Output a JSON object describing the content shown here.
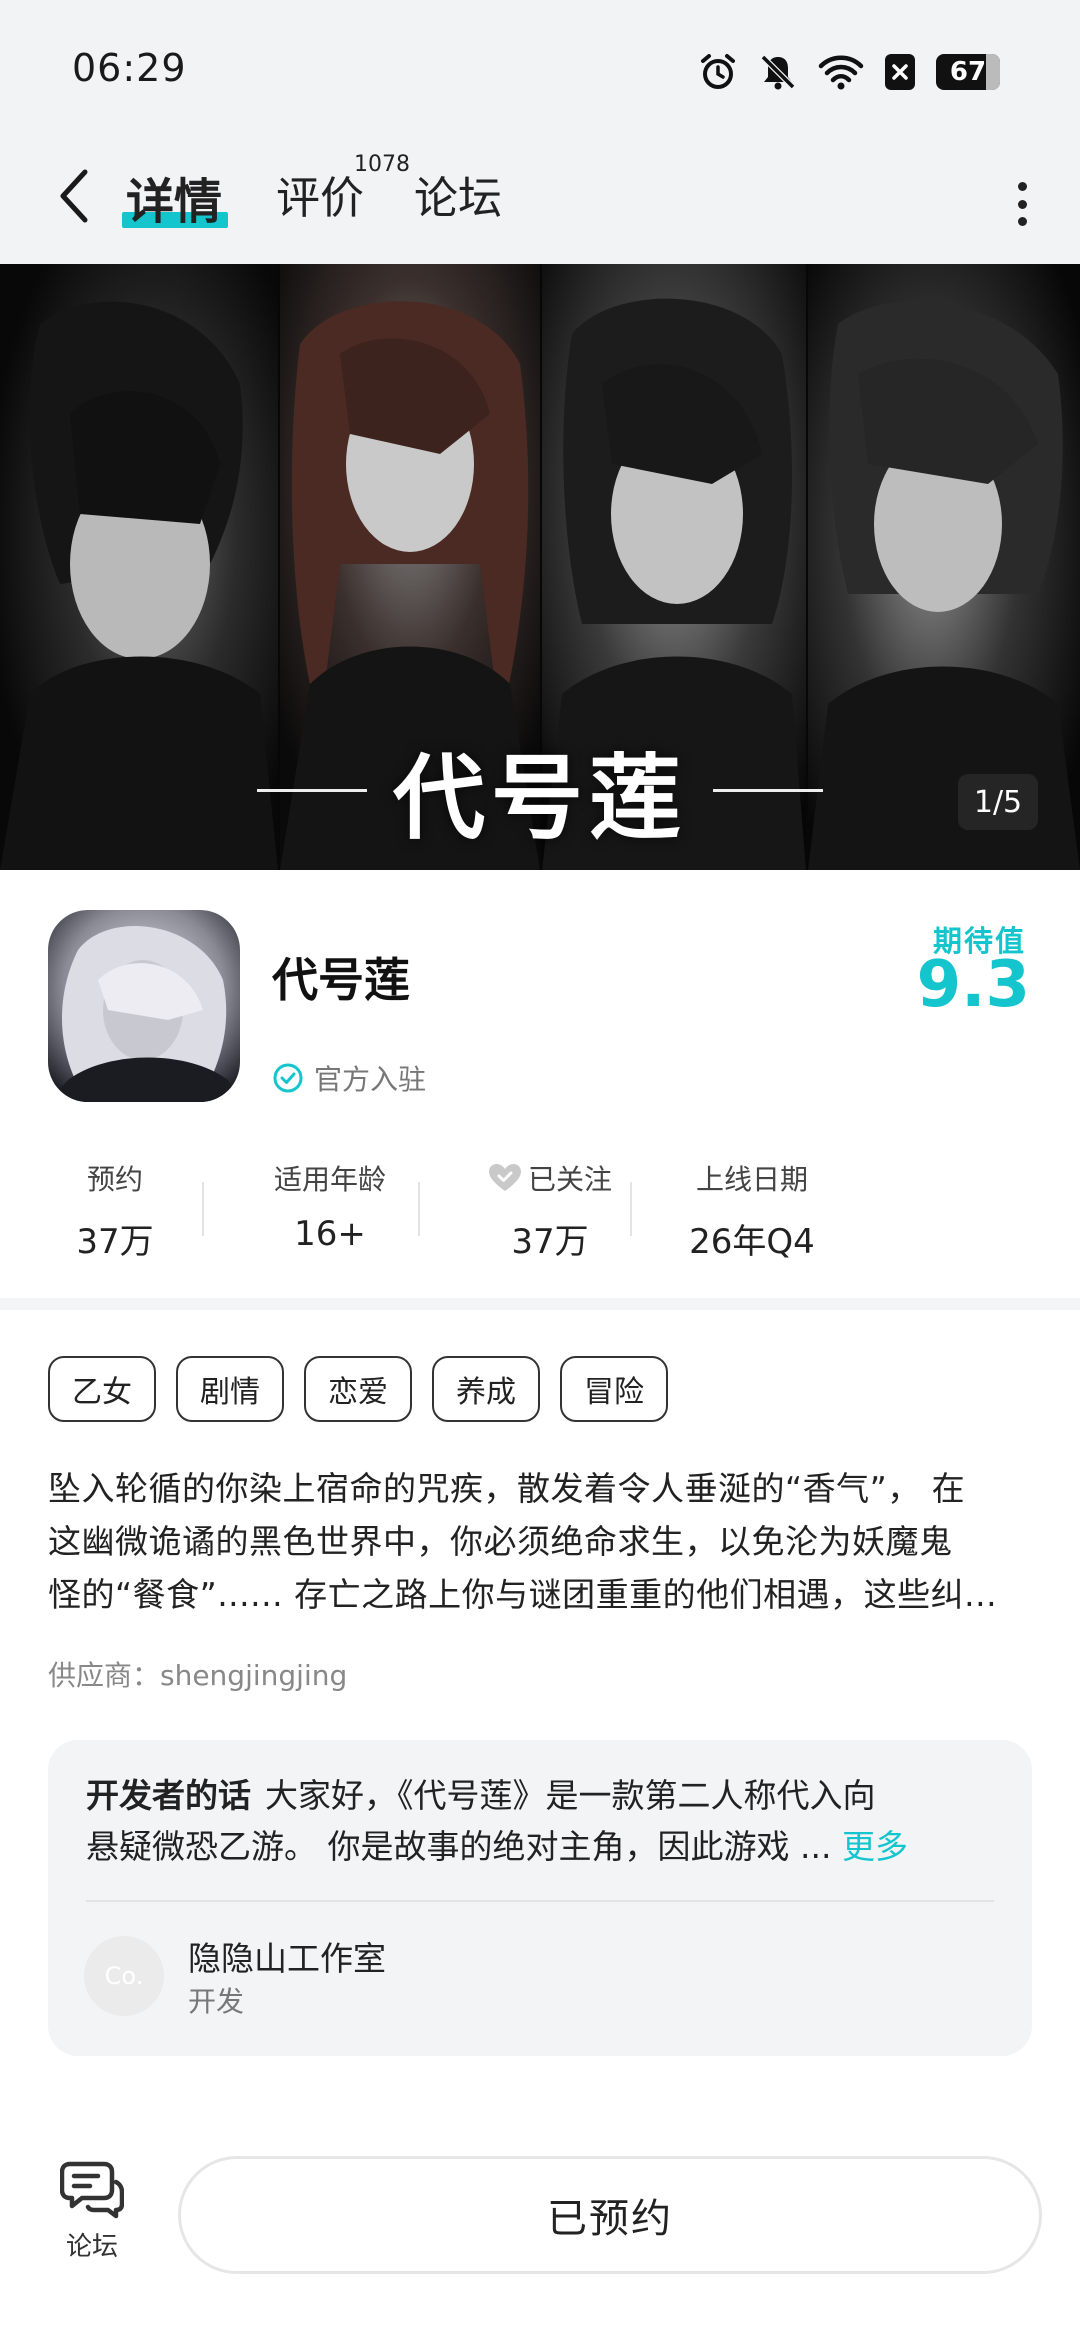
{
  "status_bar": {
    "time": "06:29",
    "battery": "67",
    "icons": [
      "alarm-icon",
      "mute-icon",
      "wifi-icon",
      "close-box-icon",
      "battery-icon"
    ]
  },
  "header": {
    "tabs": [
      {
        "label": "详情",
        "active": true
      },
      {
        "label": "评价",
        "count": "1078"
      },
      {
        "label": "论坛"
      }
    ],
    "accent_color": "#15c5ce"
  },
  "banner": {
    "title": "代号莲",
    "page_indicator": "1/5"
  },
  "app": {
    "name": "代号莲",
    "official_label": "官方入驻",
    "expect_label": "期待值",
    "expect_value": "9.3"
  },
  "stats": [
    {
      "label": "预约",
      "value": "37万"
    },
    {
      "label": "适用年龄",
      "value": "16+"
    },
    {
      "label": "已关注",
      "value": "37万"
    },
    {
      "label": "上线日期",
      "value": "26年Q4"
    }
  ],
  "tags": [
    "乙女",
    "剧情",
    "恋爱",
    "养成",
    "冒险"
  ],
  "description": {
    "lines": [
      "坠入轮循的你染上宿命的咒疾，散发着令人垂涎的“香气”， 在",
      "这幽微诡谲的黑色世界中，你必须绝命求生，以免沦为妖魔鬼",
      "怪的“餐食”...... 存亡之路上你与谜团重重的他们相遇，这些纠..."
    ]
  },
  "supplier": "供应商：shengjingjing",
  "developer": {
    "heading": "开发者的话",
    "line1": "大家好，《代号莲》是一款第二人称代入向",
    "line2": "悬疑微恐乙游。 你是故事的绝对主角，因此游戏 ...",
    "more": "更多",
    "avatar_text": "Co.",
    "studio": "隐隐山工作室",
    "role": "开发"
  },
  "bottom_bar": {
    "forum_label": "论坛",
    "reserve_label": "已预约"
  }
}
